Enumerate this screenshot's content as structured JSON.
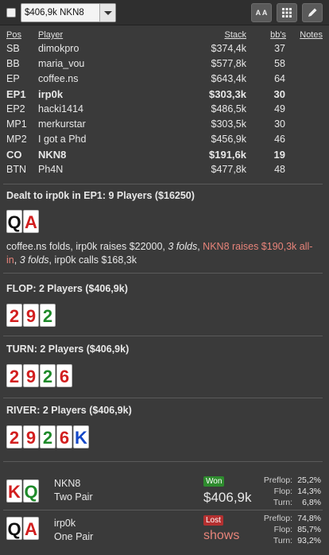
{
  "toolbar": {
    "selected_hand": "$406,9k NKN8",
    "font_button": "A A"
  },
  "table": {
    "headers": {
      "pos": "Pos",
      "player": "Player",
      "stack": "Stack",
      "bbs": "bb's",
      "notes": "Notes"
    },
    "rows": [
      {
        "pos": "SB",
        "player": "dimokpro",
        "stack": "$374,4k",
        "bbs": "37",
        "bold": false
      },
      {
        "pos": "BB",
        "player": "maria_vou",
        "stack": "$577,8k",
        "bbs": "58",
        "bold": false
      },
      {
        "pos": "EP",
        "player": "coffee.ns",
        "stack": "$643,4k",
        "bbs": "64",
        "bold": false
      },
      {
        "pos": "EP1",
        "player": "irp0k",
        "stack": "$303,3k",
        "bbs": "30",
        "bold": true
      },
      {
        "pos": "EP2",
        "player": "hacki1414",
        "stack": "$486,5k",
        "bbs": "49",
        "bold": false
      },
      {
        "pos": "MP1",
        "player": "merkurstar",
        "stack": "$303,5k",
        "bbs": "30",
        "bold": false
      },
      {
        "pos": "MP2",
        "player": "I got a Phd",
        "stack": "$456,9k",
        "bbs": "46",
        "bold": false
      },
      {
        "pos": "CO",
        "player": "NKN8",
        "stack": "$191,6k",
        "bbs": "19",
        "bold": true
      },
      {
        "pos": "BTN",
        "player": "Ph4N",
        "stack": "$477,8k",
        "bbs": "48",
        "bold": false
      }
    ]
  },
  "preflop": {
    "title": "Dealt to irp0k in EP1: 9 Players ($16250)",
    "hole_cards": [
      {
        "rank": "Q",
        "suit": "black"
      },
      {
        "rank": "A",
        "suit": "red"
      }
    ],
    "action": {
      "p1": "coffee.ns folds, irp0k raises $22000, ",
      "p2": "3 folds",
      "p3": ", ",
      "p4": "NKN8 raises $190,3k all-in",
      "p5": ", ",
      "p6": "3 folds",
      "p7": ", irp0k calls $168,3k"
    }
  },
  "flop": {
    "title": "FLOP: 2 Players ($406,9k)",
    "cards": [
      {
        "rank": "2",
        "suit": "red"
      },
      {
        "rank": "9",
        "suit": "red"
      },
      {
        "rank": "2",
        "suit": "green"
      }
    ]
  },
  "turn": {
    "title": "TURN: 2 Players ($406,9k)",
    "cards": [
      {
        "rank": "2",
        "suit": "red"
      },
      {
        "rank": "9",
        "suit": "red"
      },
      {
        "rank": "2",
        "suit": "green"
      },
      {
        "rank": "6",
        "suit": "red"
      }
    ]
  },
  "river": {
    "title": "RIVER: 2 Players ($406,9k)",
    "cards": [
      {
        "rank": "2",
        "suit": "red"
      },
      {
        "rank": "9",
        "suit": "red"
      },
      {
        "rank": "2",
        "suit": "green"
      },
      {
        "rank": "6",
        "suit": "red"
      },
      {
        "rank": "K",
        "suit": "blue"
      }
    ]
  },
  "summary": [
    {
      "cards": [
        {
          "rank": "K",
          "suit": "red"
        },
        {
          "rank": "Q",
          "suit": "green"
        }
      ],
      "name": "NKN8",
      "hand": "Two Pair",
      "result": "Won",
      "amount": "$406,9k",
      "equity": [
        {
          "street": "Preflop:",
          "value": "25,2%"
        },
        {
          "street": "Flop:",
          "value": "14,3%"
        },
        {
          "street": "Turn:",
          "value": "6,8%"
        }
      ]
    },
    {
      "cards": [
        {
          "rank": "Q",
          "suit": "black"
        },
        {
          "rank": "A",
          "suit": "red"
        }
      ],
      "name": "irp0k",
      "hand": "One Pair",
      "result": "Lost",
      "amount": "shows",
      "equity": [
        {
          "street": "Preflop:",
          "value": "74,8%"
        },
        {
          "street": "Flop:",
          "value": "85,7%"
        },
        {
          "street": "Turn:",
          "value": "93,2%"
        }
      ]
    }
  ],
  "colors": {
    "background": "#3a3a3a",
    "raise": "#e8847a",
    "won": "#2e8b2e",
    "lost": "#b43030"
  }
}
